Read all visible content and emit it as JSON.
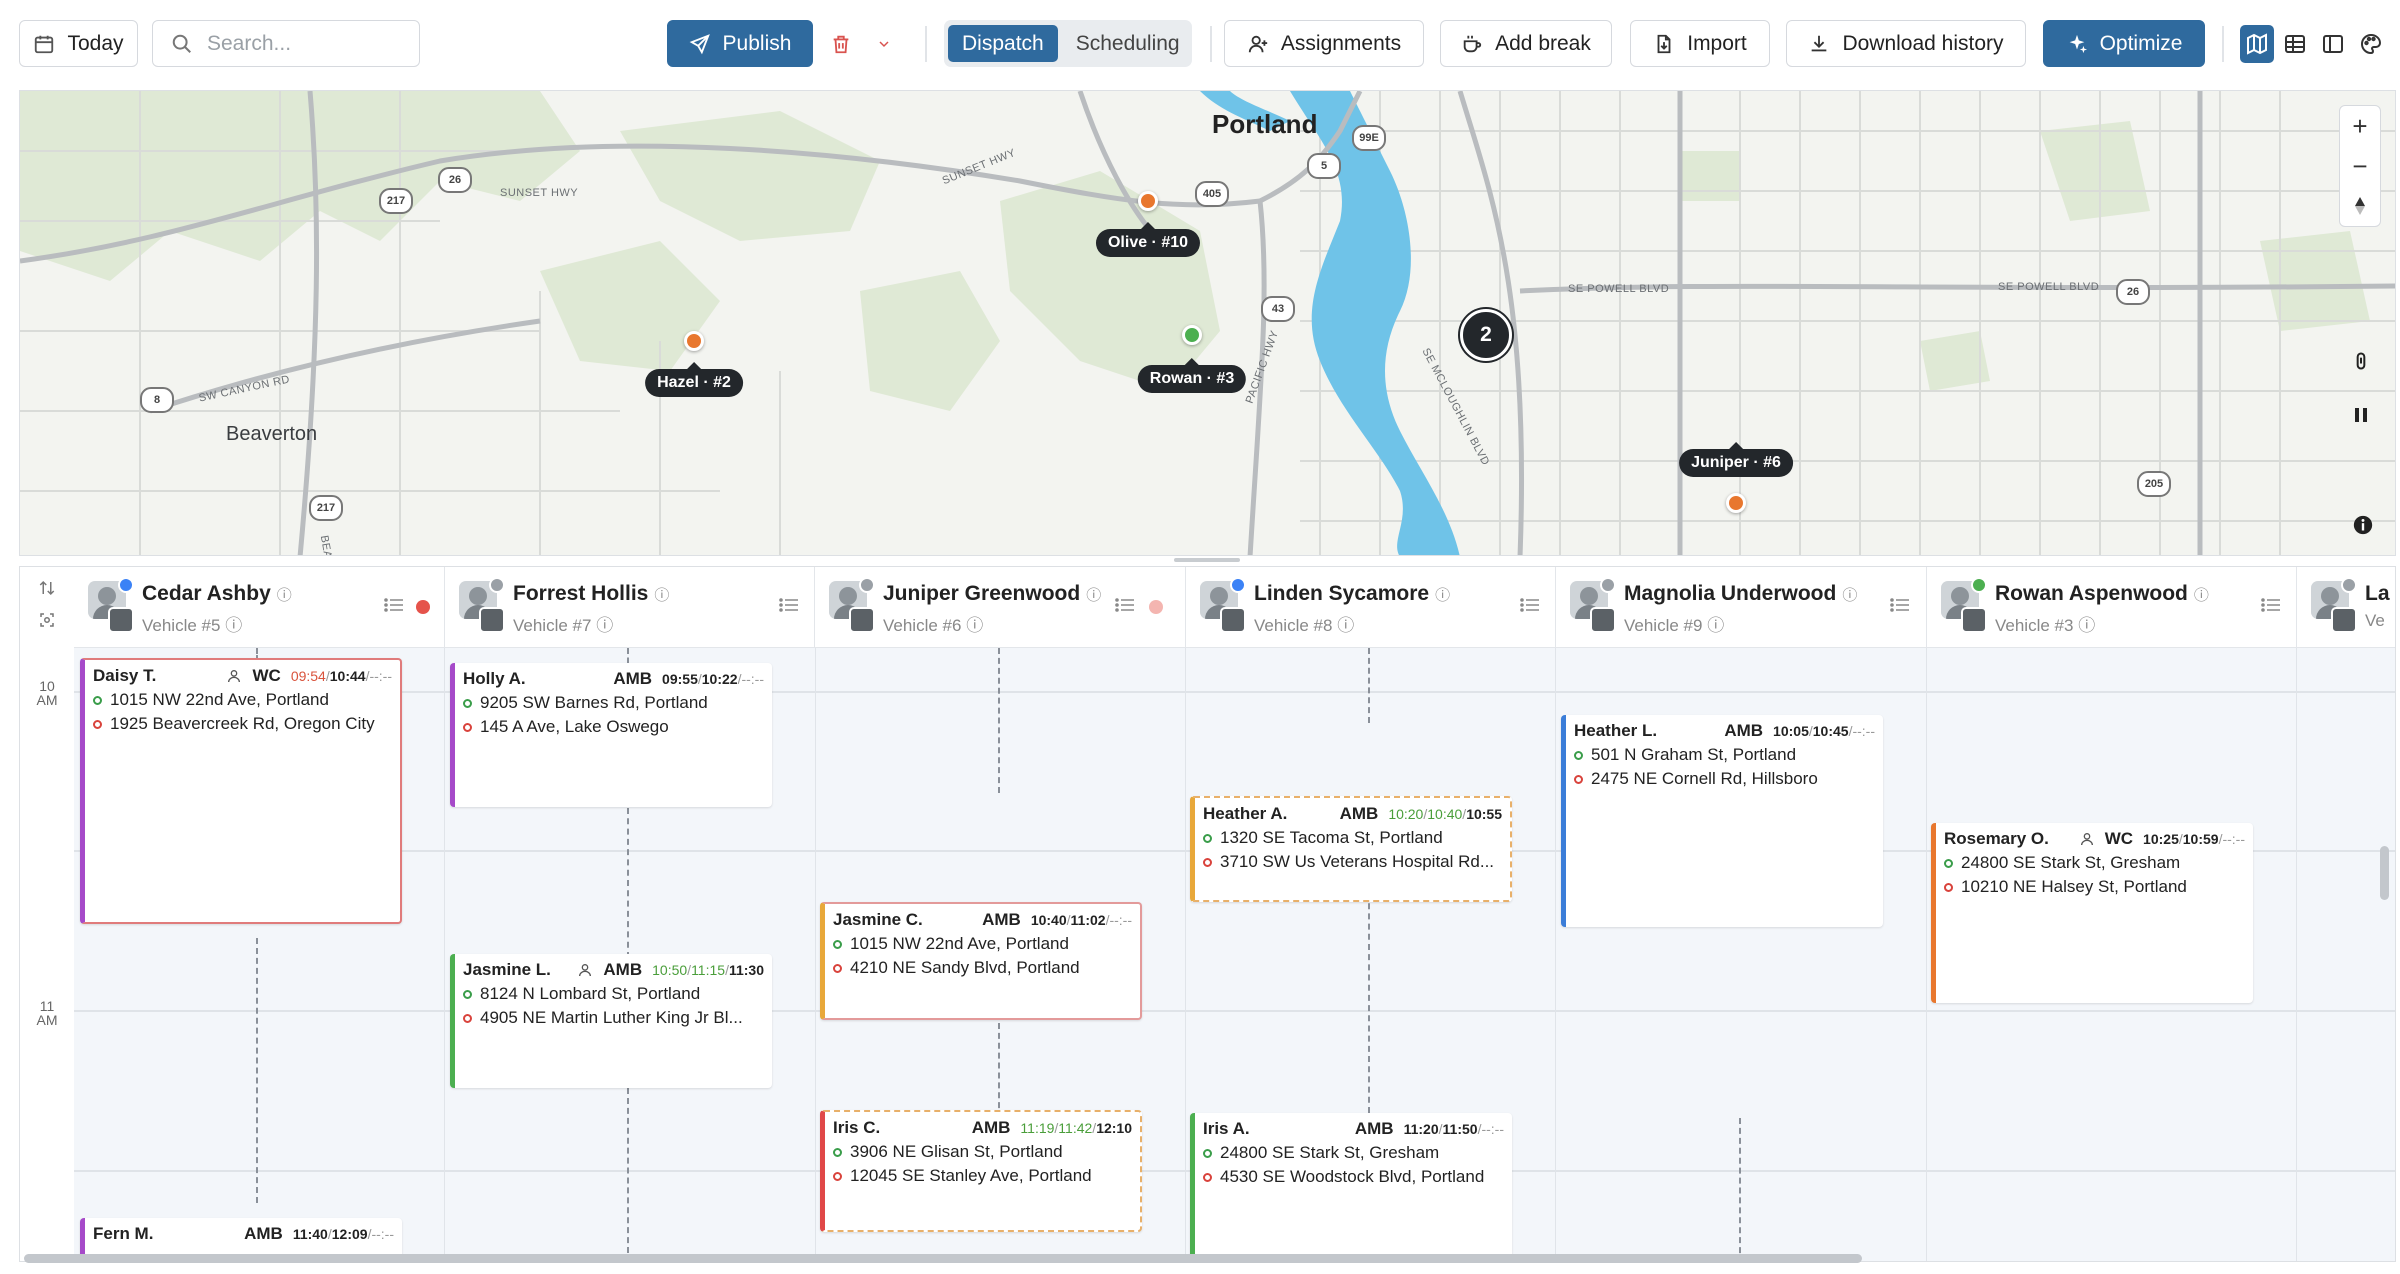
{
  "toolbar": {
    "today": "Today",
    "search_placeholder": "Search...",
    "publish": "Publish",
    "views": [
      "Dispatch",
      "Scheduling"
    ],
    "active_view": "Dispatch",
    "assignments": "Assignments",
    "add_break": "Add break",
    "import": "Import",
    "download_history": "Download history",
    "optimize": "Optimize",
    "accent": "#2f6a9e"
  },
  "map": {
    "cities": {
      "portland": "Portland",
      "beaverton": "Beaverton"
    },
    "roads": {
      "sunset_hwy": "SUNSET HWY",
      "sunset_hwy2": "SUNSET HWY",
      "canyon": "SW CANYON RD",
      "powell": "SE POWELL BLVD",
      "powell2": "SE POWELL BLVD",
      "pacific": "PACIFIC HWY",
      "mcloughlin": "SE MCLOUGHLIN BLVD",
      "bea": "BEA"
    },
    "shields": {
      "s217a": "217",
      "s26a": "26",
      "s405": "405",
      "s5": "5",
      "s99e": "99E",
      "s43": "43",
      "s8": "8",
      "s217b": "217",
      "s26b": "26",
      "s205": "205"
    },
    "markers": {
      "olive": "Olive · #10",
      "hazel": "Hazel · #2",
      "rowan": "Rowan · #3",
      "juniper": "Juniper · #6"
    },
    "cluster": "2"
  },
  "hours": {
    "h10": "10",
    "h10m": "AM",
    "h11": "11",
    "h11m": "AM"
  },
  "drivers": [
    {
      "name": "Cedar Ashby",
      "vehicle": "Vehicle #5"
    },
    {
      "name": "Forrest Hollis",
      "vehicle": "Vehicle #7"
    },
    {
      "name": "Juniper Greenwood",
      "vehicle": "Vehicle #6"
    },
    {
      "name": "Linden Sycamore",
      "vehicle": "Vehicle #8"
    },
    {
      "name": "Magnolia Underwood",
      "vehicle": "Vehicle #9"
    },
    {
      "name": "Rowan Aspenwood",
      "vehicle": "Vehicle #3"
    },
    {
      "name": "La",
      "vehicle": "Ve"
    }
  ],
  "trips": {
    "daisy": {
      "name": "Daisy T.",
      "type": "WC",
      "t1": "09:54",
      "t2": "10:44",
      "t3": "--:--",
      "pickup": "1015 NW 22nd Ave, Portland",
      "dropoff": "1925 Beavercreek Rd, Oregon City"
    },
    "holly": {
      "name": "Holly A.",
      "type": "AMB",
      "t1": "09:55",
      "t2": "10:22",
      "t3": "--:--",
      "pickup": "9205 SW Barnes Rd, Portland",
      "dropoff": "145 A Ave, Lake Oswego"
    },
    "jasmineL": {
      "name": "Jasmine L.",
      "type": "AMB",
      "t1": "10:50",
      "t2": "11:15",
      "t3": "11:30",
      "pickup": "8124 N Lombard St, Portland",
      "dropoff": "4905 NE Martin Luther King Jr Bl..."
    },
    "fern": {
      "name": "Fern M.",
      "type": "AMB",
      "t1": "11:40",
      "t2": "12:09",
      "t3": "--:--"
    },
    "jasmineC": {
      "name": "Jasmine C.",
      "type": "AMB",
      "t1": "10:40",
      "t2": "11:02",
      "t3": "--:--",
      "pickup": "1015 NW 22nd Ave, Portland",
      "dropoff": "4210 NE Sandy Blvd, Portland"
    },
    "irisC": {
      "name": "Iris C.",
      "type": "AMB",
      "t1": "11:19",
      "t2": "11:42",
      "t3": "12:10",
      "pickup": "3906 NE Glisan St, Portland",
      "dropoff": "12045 SE Stanley Ave, Portland"
    },
    "heatherA": {
      "name": "Heather A.",
      "type": "AMB",
      "t1": "10:20",
      "t2": "10:40",
      "t3": "10:55",
      "pickup": "1320 SE Tacoma St, Portland",
      "dropoff": "3710 SW Us Veterans Hospital Rd..."
    },
    "irisA": {
      "name": "Iris A.",
      "type": "AMB",
      "t1": "11:20",
      "t2": "11:50",
      "t3": "--:--",
      "pickup": "24800 SE Stark St, Gresham",
      "dropoff": "4530 SE Woodstock Blvd, Portland"
    },
    "heatherL": {
      "name": "Heather L.",
      "type": "AMB",
      "t1": "10:05",
      "t2": "10:45",
      "t3": "--:--",
      "pickup": "501 N Graham St, Portland",
      "dropoff": "2475 NE Cornell Rd, Hillsboro"
    },
    "rosemary": {
      "name": "Rosemary O.",
      "type": "WC",
      "t1": "10:25",
      "t2": "10:59",
      "t3": "--:--",
      "pickup": "24800 SE Stark St, Gresham",
      "dropoff": "10210 NE Halsey St, Portland"
    }
  },
  "sep": "/"
}
